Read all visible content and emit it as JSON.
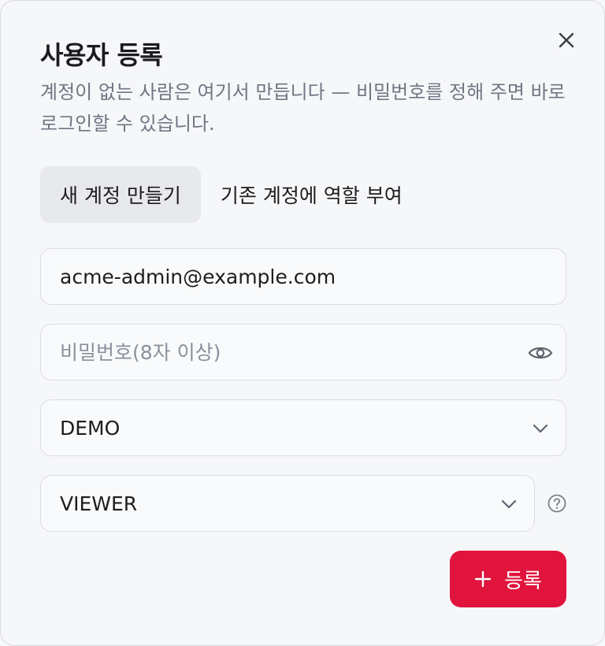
{
  "dialog": {
    "title": "사용자 등록",
    "description": "계정이 없는 사람은 여기서 만듭니다 — 비밀번호를 정해 주면 바로 로그인할 수 있습니다."
  },
  "tabs": [
    {
      "label": "새 계정 만들기",
      "active": true
    },
    {
      "label": "기존 계정에 역할 부여",
      "active": false
    }
  ],
  "form": {
    "email": {
      "value": "acme-admin@example.com"
    },
    "password": {
      "value": "",
      "placeholder": "비밀번호(8자 이상)"
    },
    "organization": {
      "selected": "DEMO"
    },
    "role": {
      "selected": "VIEWER"
    },
    "submit_label": "등록"
  },
  "icons": {
    "close": "close-icon",
    "password_toggle": "eye-icon",
    "dropdown": "chevron-down-icon",
    "help": "help-circle-icon",
    "add": "plus-icon"
  },
  "colors": {
    "accent": "#e0143c",
    "muted_text": "#707683",
    "border": "#dadce1"
  }
}
